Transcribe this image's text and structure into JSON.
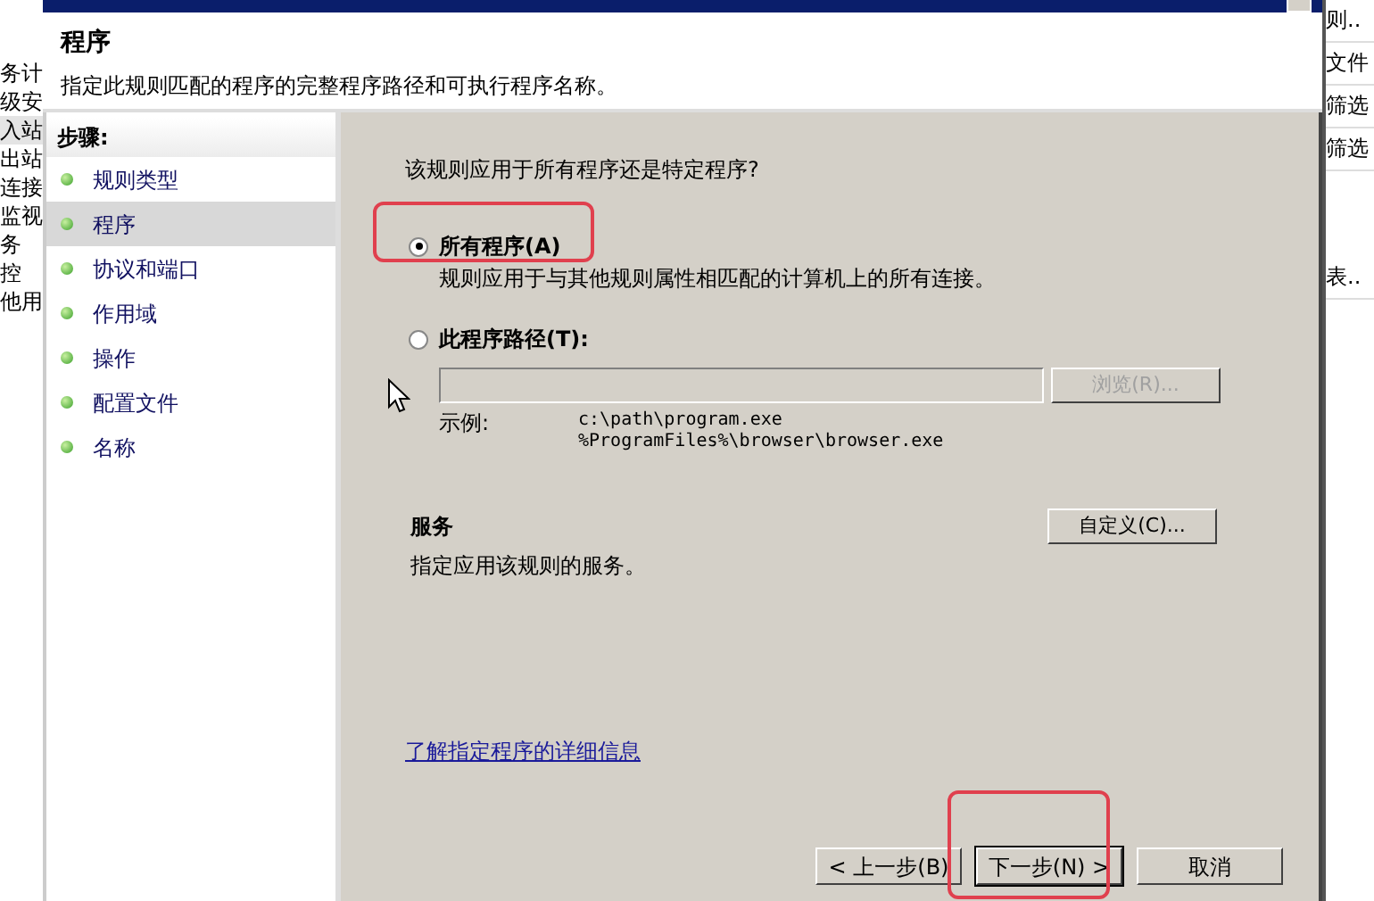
{
  "background_left": {
    "items": [
      {
        "label": "务计",
        "selected": false
      },
      {
        "label": "级安",
        "selected": false
      },
      {
        "label": "入站",
        "selected": true
      },
      {
        "label": "出站",
        "selected": false
      },
      {
        "label": "连接",
        "selected": false
      },
      {
        "label": "监视",
        "selected": false
      },
      {
        "label": "务",
        "selected": false
      },
      {
        "label": "控",
        "selected": false
      },
      {
        "label": "他用",
        "selected": false
      }
    ]
  },
  "background_right": {
    "items": [
      "则..",
      "文件",
      "筛选",
      "筛选",
      "表.."
    ]
  },
  "dialog": {
    "header": {
      "title": "程序",
      "subtitle": "指定此规则匹配的程序的完整程序路径和可执行程序名称。"
    },
    "steps": {
      "heading": "步骤:",
      "items": [
        {
          "label": "规则类型",
          "selected": false
        },
        {
          "label": "程序",
          "selected": true
        },
        {
          "label": "协议和端口",
          "selected": false
        },
        {
          "label": "作用域",
          "selected": false
        },
        {
          "label": "操作",
          "selected": false
        },
        {
          "label": "配置文件",
          "selected": false
        },
        {
          "label": "名称",
          "selected": false
        }
      ]
    },
    "question": "该规则应用于所有程序还是特定程序?",
    "options": [
      {
        "label": "所有程序(A)",
        "description": "规则应用于与其他规则属性相匹配的计算机上的所有连接。",
        "selected": true
      },
      {
        "label": "此程序路径(T):",
        "selected": false
      }
    ],
    "path_field": {
      "disabled": true
    },
    "browse_button": {
      "label": "浏览(R)...",
      "disabled": true
    },
    "example_label": "示例:",
    "examples": [
      "c:\\path\\program.exe",
      "%ProgramFiles%\\browser\\browser.exe"
    ],
    "services": {
      "title": "服务",
      "description": "指定应用该规则的服务。",
      "button": "自定义(C)..."
    },
    "link": "了解指定程序的详细信息",
    "buttons": [
      {
        "label": "< 上一步(B)",
        "kind": "normal"
      },
      {
        "label": "下一步(N) >",
        "kind": "default"
      },
      {
        "label": "取消",
        "kind": "normal"
      }
    ]
  }
}
